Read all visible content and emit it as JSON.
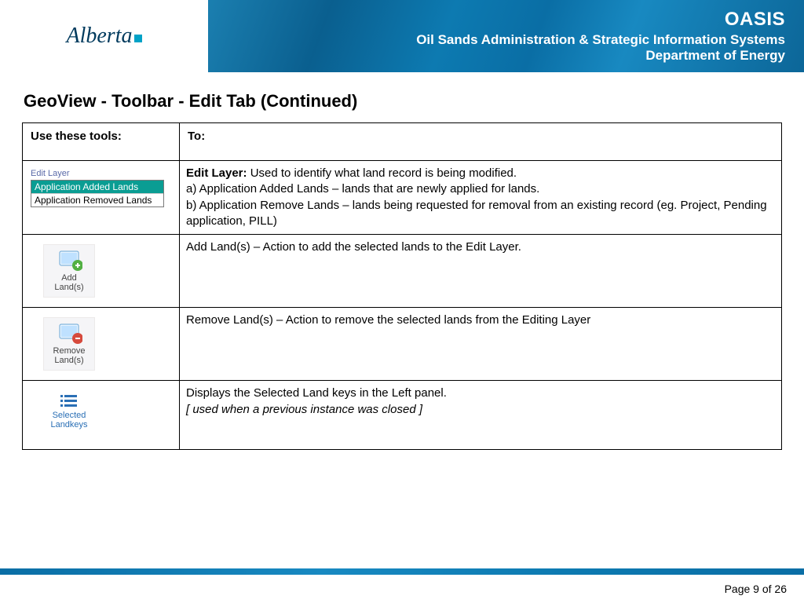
{
  "header": {
    "logo_text": "Alberta",
    "banner_title": "OASIS",
    "banner_sub1": "Oil Sands Administration & Strategic Information Systems",
    "banner_sub2": "Department of Energy"
  },
  "page_title": "GeoView  - Toolbar - Edit Tab (Continued)",
  "table": {
    "col1": "Use these tools:",
    "col2": "To:",
    "rows": [
      {
        "tool": {
          "type": "edit-layer",
          "label": "Edit Layer",
          "option_selected": "Application Added Lands",
          "option_other": "Application Removed Lands"
        },
        "desc_bold": "Edit Layer:",
        "desc_rest": "  Used to identify what land record is being modified.",
        "desc_a": "a) Application Added Lands – lands that are newly applied for lands.",
        "desc_b": "b) Application Remove Lands – lands being requested for removal from an existing record (eg. Project, Pending application, PILL)"
      },
      {
        "tool": {
          "type": "add",
          "caption1": "Add",
          "caption2": "Land(s)"
        },
        "desc": "Add Land(s) – Action to add the selected lands to the Edit Layer."
      },
      {
        "tool": {
          "type": "remove",
          "caption1": "Remove",
          "caption2": "Land(s)"
        },
        "desc": "Remove Land(s) – Action to remove the selected lands from the Editing Layer"
      },
      {
        "tool": {
          "type": "selected",
          "caption1": "Selected",
          "caption2": "Landkeys"
        },
        "desc": "Displays the Selected Land keys in the Left panel.",
        "desc_ital": "[ used when a previous instance was closed ]"
      }
    ]
  },
  "footer": {
    "page": "Page 9 of 26"
  }
}
